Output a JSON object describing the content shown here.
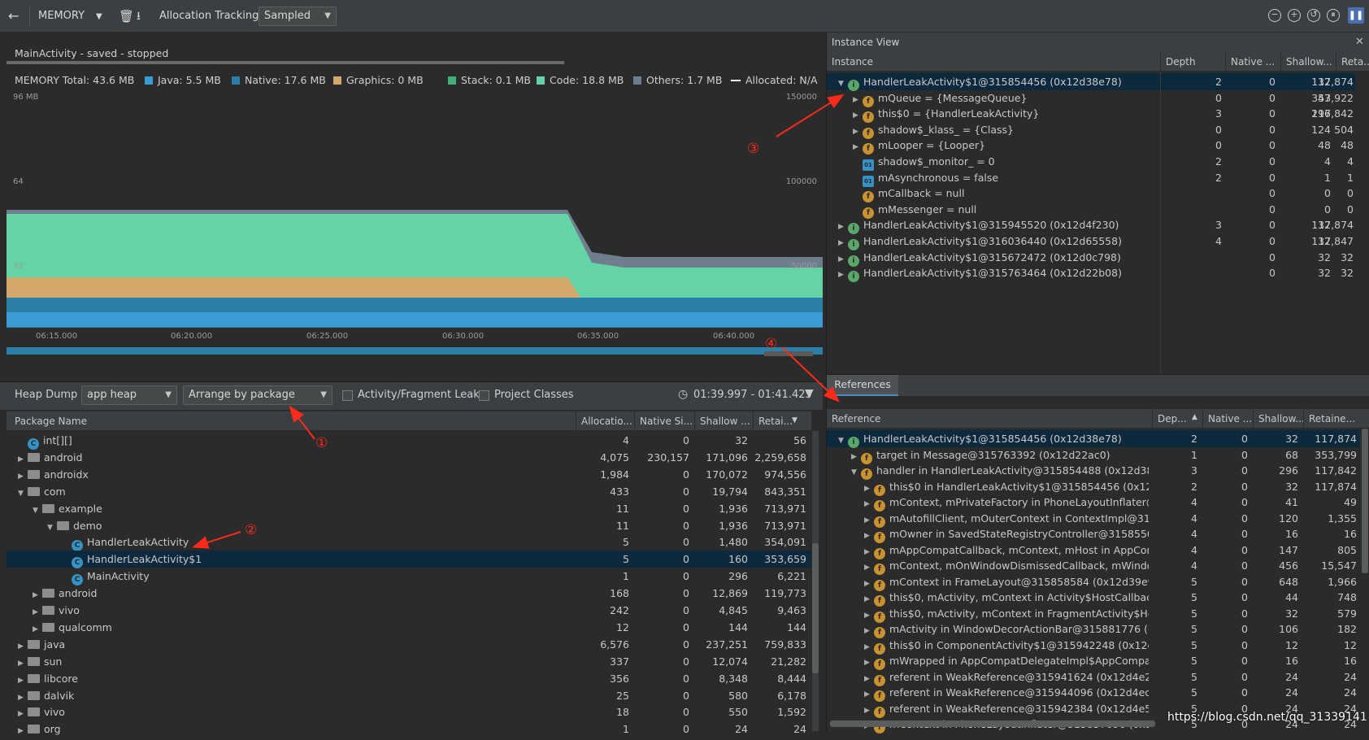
{
  "toolbar": {
    "back_icon": "arrow-left-icon",
    "profiler_label": "MEMORY",
    "allocation_tracking_label": "Allocation Tracking",
    "allocation_mode": "Sampled"
  },
  "session": {
    "title": "MainActivity - saved - stopped"
  },
  "legend": {
    "total": "MEMORY Total: 43.6 MB",
    "items": [
      {
        "label": "Java: 5.5 MB",
        "color": "#3a9bd5"
      },
      {
        "label": "Native: 17.6 MB",
        "color": "#2b7fa8"
      },
      {
        "label": "Graphics: 0 MB",
        "color": "#d4a86a"
      },
      {
        "label": "Stack: 0.1 MB",
        "color": "#3fb07a"
      },
      {
        "label": "Code: 18.8 MB",
        "color": "#64d3a6"
      },
      {
        "label": "Others: 1.7 MB",
        "color": "#6e7e8c"
      },
      {
        "label": "Allocated: N/A",
        "color": "#ffffff"
      }
    ]
  },
  "chart": {
    "y_left_top": "96 MB",
    "y_left_labels": [
      "64",
      "32"
    ],
    "y_right_labels": [
      "150000",
      "100000",
      "50000"
    ],
    "x_labels": [
      "06:15.000",
      "06:20.000",
      "06:25.000",
      "06:30.000",
      "06:35.000",
      "06:40.000"
    ],
    "gc_icon": "trash-icon"
  },
  "heap": {
    "label": "Heap Dump",
    "heap_select": "app heap",
    "arrange_select": "Arrange by package",
    "checkbox_leaks": "Activity/Fragment Leaks",
    "checkbox_project": "Project Classes",
    "time_range": "01:39.997 - 01:41.425",
    "columns": [
      "Package Name",
      "Allocatio...",
      "Native Si...",
      "Shallow ...",
      "Retai..."
    ],
    "rows": [
      {
        "name": "int[][]",
        "alloc": "4",
        "native": "0",
        "shallow": "32",
        "retained": "56"
      },
      {
        "name": "android",
        "alloc": "4,075",
        "native": "230,157",
        "shallow": "171,096",
        "retained": "2,259,658"
      },
      {
        "name": "androidx",
        "alloc": "1,984",
        "native": "0",
        "shallow": "170,072",
        "retained": "974,556"
      },
      {
        "name": "com",
        "alloc": "433",
        "native": "0",
        "shallow": "19,794",
        "retained": "843,351"
      },
      {
        "name": "example",
        "alloc": "11",
        "native": "0",
        "shallow": "1,936",
        "retained": "713,971"
      },
      {
        "name": "demo",
        "alloc": "11",
        "native": "0",
        "shallow": "1,936",
        "retained": "713,971"
      },
      {
        "name": "HandlerLeakActivity",
        "alloc": "5",
        "native": "0",
        "shallow": "1,480",
        "retained": "354,091"
      },
      {
        "name": "HandlerLeakActivity$1",
        "alloc": "5",
        "native": "0",
        "shallow": "160",
        "retained": "353,659"
      },
      {
        "name": "MainActivity",
        "alloc": "1",
        "native": "0",
        "shallow": "296",
        "retained": "6,221"
      },
      {
        "name": "android",
        "alloc": "168",
        "native": "0",
        "shallow": "12,869",
        "retained": "119,773"
      },
      {
        "name": "vivo",
        "alloc": "242",
        "native": "0",
        "shallow": "4,845",
        "retained": "9,463"
      },
      {
        "name": "qualcomm",
        "alloc": "12",
        "native": "0",
        "shallow": "144",
        "retained": "144"
      },
      {
        "name": "java",
        "alloc": "6,576",
        "native": "0",
        "shallow": "237,251",
        "retained": "759,833"
      },
      {
        "name": "sun",
        "alloc": "337",
        "native": "0",
        "shallow": "12,074",
        "retained": "21,282"
      },
      {
        "name": "libcore",
        "alloc": "356",
        "native": "0",
        "shallow": "8,348",
        "retained": "8,444"
      },
      {
        "name": "dalvik",
        "alloc": "25",
        "native": "0",
        "shallow": "580",
        "retained": "6,178"
      },
      {
        "name": "vivo",
        "alloc": "18",
        "native": "0",
        "shallow": "550",
        "retained": "1,592"
      },
      {
        "name": "org",
        "alloc": "1",
        "native": "0",
        "shallow": "24",
        "retained": "24"
      }
    ]
  },
  "instance_view": {
    "title": "Instance View",
    "columns": [
      "Instance",
      "Depth",
      "Native ...",
      "Shallow...",
      "Reta..."
    ],
    "rows": [
      {
        "name": "HandlerLeakActivity$1@315854456 (0x12d38e78)",
        "depth": "2",
        "native": "0",
        "shallow": "32",
        "retained": "117,874"
      },
      {
        "name": "mQueue = {MessageQueue}",
        "depth": "0",
        "native": "0",
        "shallow": "47",
        "retained": "353,922"
      },
      {
        "name": "this$0 = {HandlerLeakActivity}",
        "depth": "3",
        "native": "0",
        "shallow": "296",
        "retained": "117,842"
      },
      {
        "name": "shadow$_klass_ = {Class}",
        "depth": "0",
        "native": "0",
        "shallow": "124",
        "retained": "504"
      },
      {
        "name": "mLooper = {Looper}",
        "depth": "0",
        "native": "0",
        "shallow": "48",
        "retained": "48"
      },
      {
        "name": "shadow$_monitor_ = 0",
        "depth": "2",
        "native": "0",
        "shallow": "4",
        "retained": "4"
      },
      {
        "name": "mAsynchronous = false",
        "depth": "2",
        "native": "0",
        "shallow": "1",
        "retained": "1"
      },
      {
        "name": "mCallback = null",
        "depth": "",
        "native": "0",
        "shallow": "0",
        "retained": "0"
      },
      {
        "name": "mMessenger = null",
        "depth": "",
        "native": "0",
        "shallow": "0",
        "retained": "0"
      },
      {
        "name": "HandlerLeakActivity$1@315945520 (0x12d4f230)",
        "depth": "3",
        "native": "0",
        "shallow": "32",
        "retained": "117,874"
      },
      {
        "name": "HandlerLeakActivity$1@316036440 (0x12d65558)",
        "depth": "4",
        "native": "0",
        "shallow": "32",
        "retained": "117,847"
      },
      {
        "name": "HandlerLeakActivity$1@315672472 (0x12d0c798)",
        "depth": "",
        "native": "0",
        "shallow": "32",
        "retained": "32"
      },
      {
        "name": "HandlerLeakActivity$1@315763464 (0x12d22b08)",
        "depth": "",
        "native": "0",
        "shallow": "32",
        "retained": "32"
      }
    ]
  },
  "references": {
    "tab": "References",
    "columns": [
      "Reference",
      "Dep...",
      "Native ...",
      "Shallow...",
      "Retaine..."
    ],
    "rows": [
      {
        "name": "HandlerLeakActivity$1@315854456 (0x12d38e78)",
        "depth": "2",
        "native": "0",
        "shallow": "32",
        "retained": "117,874"
      },
      {
        "name": "target in Message@315763392 (0x12d22ac0)",
        "depth": "1",
        "native": "0",
        "shallow": "68",
        "retained": "353,799"
      },
      {
        "name": "handler in HandlerLeakActivity@315854488 (0x12d38e98)",
        "depth": "3",
        "native": "0",
        "shallow": "296",
        "retained": "117,842"
      },
      {
        "name": "this$0 in HandlerLeakActivity$1@315854456 (0x12d38e",
        "depth": "2",
        "native": "0",
        "shallow": "32",
        "retained": "117,874"
      },
      {
        "name": "mContext, mPrivateFactory in PhoneLayoutInflater@31",
        "depth": "4",
        "native": "0",
        "shallow": "41",
        "retained": "49"
      },
      {
        "name": "mAutofillClient, mOuterContext in ContextImpl@3158",
        "depth": "4",
        "native": "0",
        "shallow": "120",
        "retained": "1,355"
      },
      {
        "name": "mOwner in SavedStateRegistryController@315855072",
        "depth": "4",
        "native": "0",
        "shallow": "16",
        "retained": "16"
      },
      {
        "name": "mAppCompatCallback, mContext, mHost in AppComp",
        "depth": "4",
        "native": "0",
        "shallow": "147",
        "retained": "805"
      },
      {
        "name": "mContext, mOnWindowDismissedCallback, mWindowC",
        "depth": "4",
        "native": "0",
        "shallow": "456",
        "retained": "15,547"
      },
      {
        "name": "mContext in FrameLayout@315858584 (0x12d39e98)",
        "depth": "5",
        "native": "0",
        "shallow": "648",
        "retained": "1,966"
      },
      {
        "name": "this$0, mActivity, mContext in Activity$HostCallbacks@",
        "depth": "5",
        "native": "0",
        "shallow": "44",
        "retained": "748"
      },
      {
        "name": "this$0, mActivity, mContext in FragmentActivity$HostCa",
        "depth": "5",
        "native": "0",
        "shallow": "32",
        "retained": "579"
      },
      {
        "name": "mActivity in WindowDecorActionBar@315881776 (0x12",
        "depth": "5",
        "native": "0",
        "shallow": "106",
        "retained": "182"
      },
      {
        "name": "this$0 in ComponentActivity$1@315942248 (0x12d4e5",
        "depth": "5",
        "native": "0",
        "shallow": "12",
        "retained": "12"
      },
      {
        "name": "mWrapped in AppCompatDelegateImpl$AppCompatW",
        "depth": "5",
        "native": "0",
        "shallow": "16",
        "retained": "16"
      },
      {
        "name": "referent in WeakReference@315941624 (0x12d4e2f8)",
        "depth": "5",
        "native": "0",
        "shallow": "24",
        "retained": "24"
      },
      {
        "name": "referent in WeakReference@315944096 (0x12d4eca0)",
        "depth": "5",
        "native": "0",
        "shallow": "24",
        "retained": "24"
      },
      {
        "name": "referent in WeakReference@315942384 (0x12d4e5f0)",
        "depth": "5",
        "native": "0",
        "shallow": "24",
        "retained": "24"
      },
      {
        "name": "mContext in PhoneLayoutInflater@315857096 (0x12d3",
        "depth": "5",
        "native": "0",
        "shallow": "24",
        "retained": "24"
      }
    ]
  },
  "annotations": [
    "①",
    "②",
    "③",
    "④"
  ],
  "watermark": "https://blog.csdn.net/qq_31339141"
}
